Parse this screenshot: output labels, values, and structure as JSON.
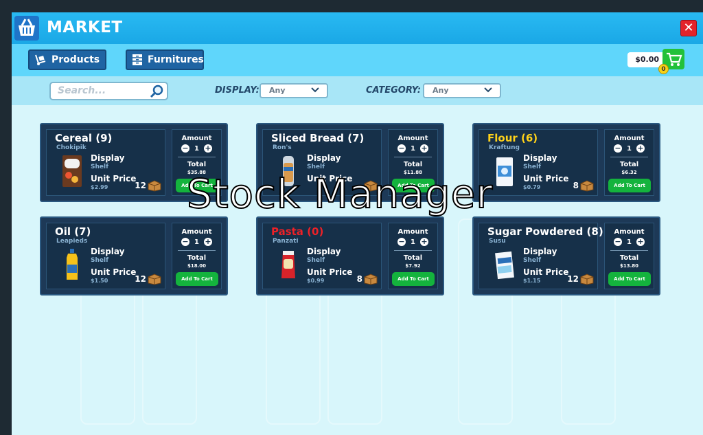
{
  "window": {
    "title": "MARKET",
    "close_label": "✕"
  },
  "tabs": [
    {
      "label": "Products"
    },
    {
      "label": "Furnitures"
    }
  ],
  "wallet": {
    "balance": "$0.00",
    "cart_count": "0"
  },
  "filters": {
    "search_placeholder": "Search...",
    "display_label": "DISPLAY:",
    "display_value": "Any",
    "category_label": "CATEGORY:",
    "category_value": "Any"
  },
  "products": [
    {
      "name": "Cereal (9)",
      "brand": "Chokipik",
      "display_label": "Display",
      "display_type": "Shelf",
      "unit_price_label": "Unit Price",
      "unit_price": "$2.99",
      "stock": "12",
      "amount_label": "Amount",
      "amount": "1",
      "total_label": "Total",
      "total": "$35.88",
      "add_label": "Add To Cart"
    },
    {
      "name": "Sliced Bread (7)",
      "brand": "Ron's",
      "display_label": "Display",
      "display_type": "Shelf",
      "unit_price_label": "Unit Price",
      "unit_price": "",
      "stock": "",
      "amount_label": "Amount",
      "amount": "1",
      "total_label": "Total",
      "total": "$11.88",
      "add_label": "Add To Cart"
    },
    {
      "name": "Flour (6)",
      "brand": "Kraftung",
      "display_label": "Display",
      "display_type": "Shelf",
      "unit_price_label": "Unit Price",
      "unit_price": "$0.79",
      "stock": "8",
      "amount_label": "Amount",
      "amount": "1",
      "total_label": "Total",
      "total": "$6.32",
      "add_label": "Add To Cart"
    },
    {
      "name": "Oil (7)",
      "brand": "Leapieds",
      "display_label": "Display",
      "display_type": "Shelf",
      "unit_price_label": "Unit Price",
      "unit_price": "$1.50",
      "stock": "12",
      "amount_label": "Amount",
      "amount": "1",
      "total_label": "Total",
      "total": "$18.00",
      "add_label": "Add To Cart"
    },
    {
      "name": "Pasta (0)",
      "brand": "Panzati",
      "display_label": "Display",
      "display_type": "Shelf",
      "unit_price_label": "Unit Price",
      "unit_price": "$0.99",
      "stock": "8",
      "amount_label": "Amount",
      "amount": "1",
      "total_label": "Total",
      "total": "$7.92",
      "add_label": "Add To Cart"
    },
    {
      "name": "Sugar Powdered (8)",
      "brand": "Susu",
      "display_label": "Display",
      "display_type": "Shelf",
      "unit_price_label": "Unit Price",
      "unit_price": "$1.15",
      "stock": "12",
      "amount_label": "Amount",
      "amount": "1",
      "total_label": "Total",
      "total": "$13.80",
      "add_label": "Add To Cart"
    }
  ],
  "overlay_text": "Stock Manager",
  "colors": {
    "accent": "#29b9f2",
    "card": "#1d3957",
    "add_button": "#14b33d",
    "warning": "#ffd21a",
    "danger": "#ee2127"
  }
}
